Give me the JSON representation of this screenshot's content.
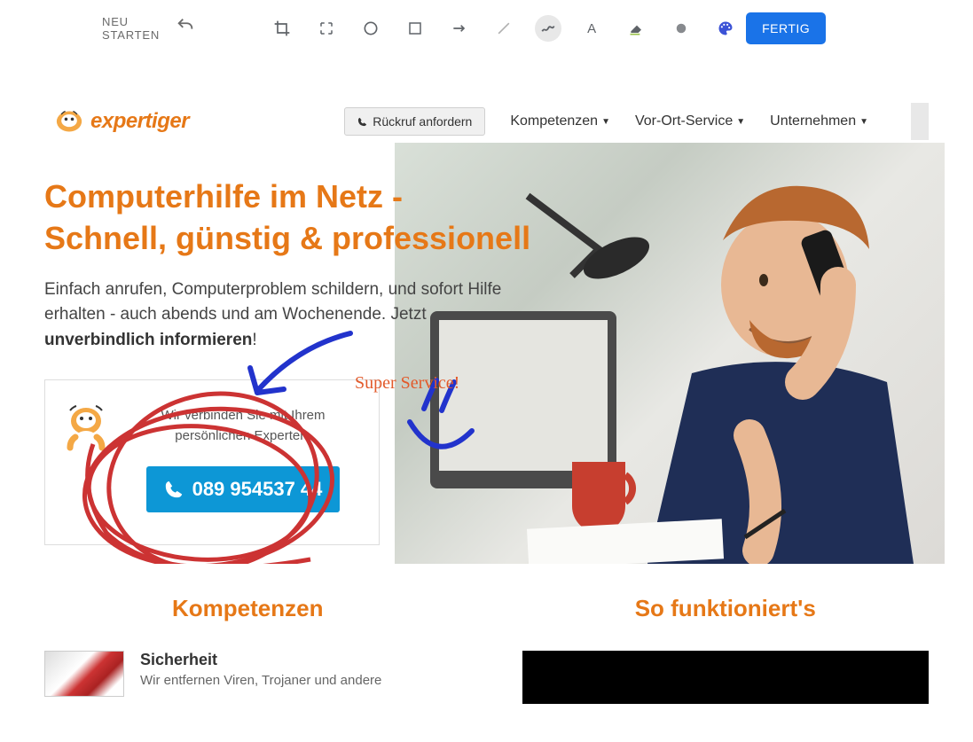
{
  "editor": {
    "restart_label": "NEU STARTEN",
    "done_label": "FERTIG"
  },
  "header": {
    "logo_text": "expertiger",
    "callback_label": "Rückruf anfordern",
    "nav_items": [
      {
        "label": "Kompetenzen"
      },
      {
        "label": "Vor-Ort-Service"
      },
      {
        "label": "Unternehmen"
      }
    ]
  },
  "hero": {
    "title_line1": "Computerhilfe im Netz -",
    "title_line2": "Schnell, günstig & professionell",
    "subtitle_part1": "Einfach anrufen, Computerproblem schildern, und sofort Hilfe erhalten - auch abends und am Wochenende. Jetzt ",
    "subtitle_bold": "unverbindlich informieren",
    "subtitle_part2": "!",
    "contact_text": "Wir verbinden Sie mit Ihrem persönlichen Experten.",
    "phone_number": "089 954537 44"
  },
  "annotations": {
    "super_service": "Super Service!",
    "colors": {
      "circle": "#cc3333",
      "arrow_smiley": "#2233cc",
      "text": "#e25a2b"
    }
  },
  "columns": {
    "left_title": "Kompetenzen",
    "right_title": "So funktioniert's",
    "competence": {
      "title": "Sicherheit",
      "desc": "Wir entfernen Viren, Trojaner und andere"
    }
  }
}
